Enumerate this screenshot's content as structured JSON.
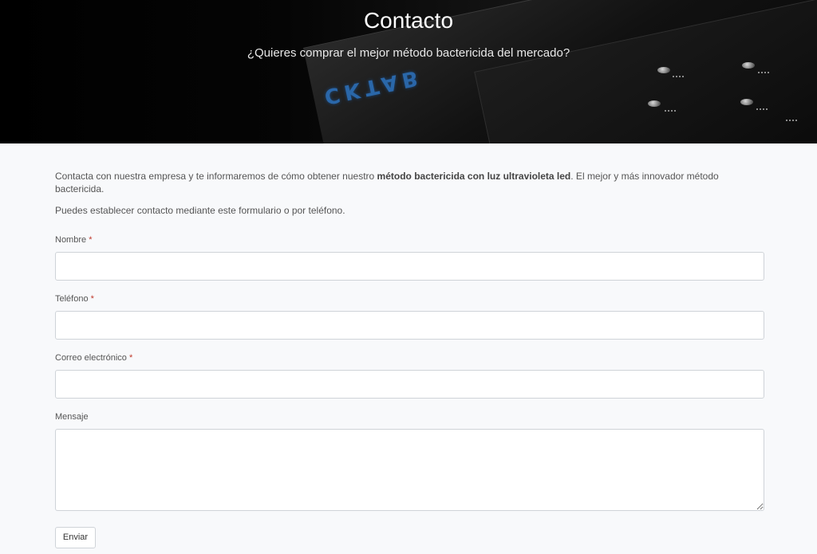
{
  "hero": {
    "title": "Contacto",
    "subtitle": "¿Quieres comprar el mejor método bactericida del mercado?",
    "brand_text": "CKTAB"
  },
  "intro": {
    "line1_before": "Contacta con nuestra empresa y te informaremos de cómo obtener nuestro ",
    "line1_bold": "método bactericida con luz ultravioleta led",
    "line1_after": ". El mejor y más innovador método bactericida.",
    "line2": "Puedes establecer contacto mediante este formulario o por teléfono."
  },
  "form": {
    "name_label": "Nombre",
    "phone_label": "Teléfono",
    "email_label": "Correo electrónico",
    "message_label": "Mensaje",
    "required_mark": "*",
    "submit_label": "Enviar"
  },
  "colors": {
    "required": "#c0392b",
    "brand": "#2c6fb8",
    "page_background": "#f8f9fb"
  }
}
